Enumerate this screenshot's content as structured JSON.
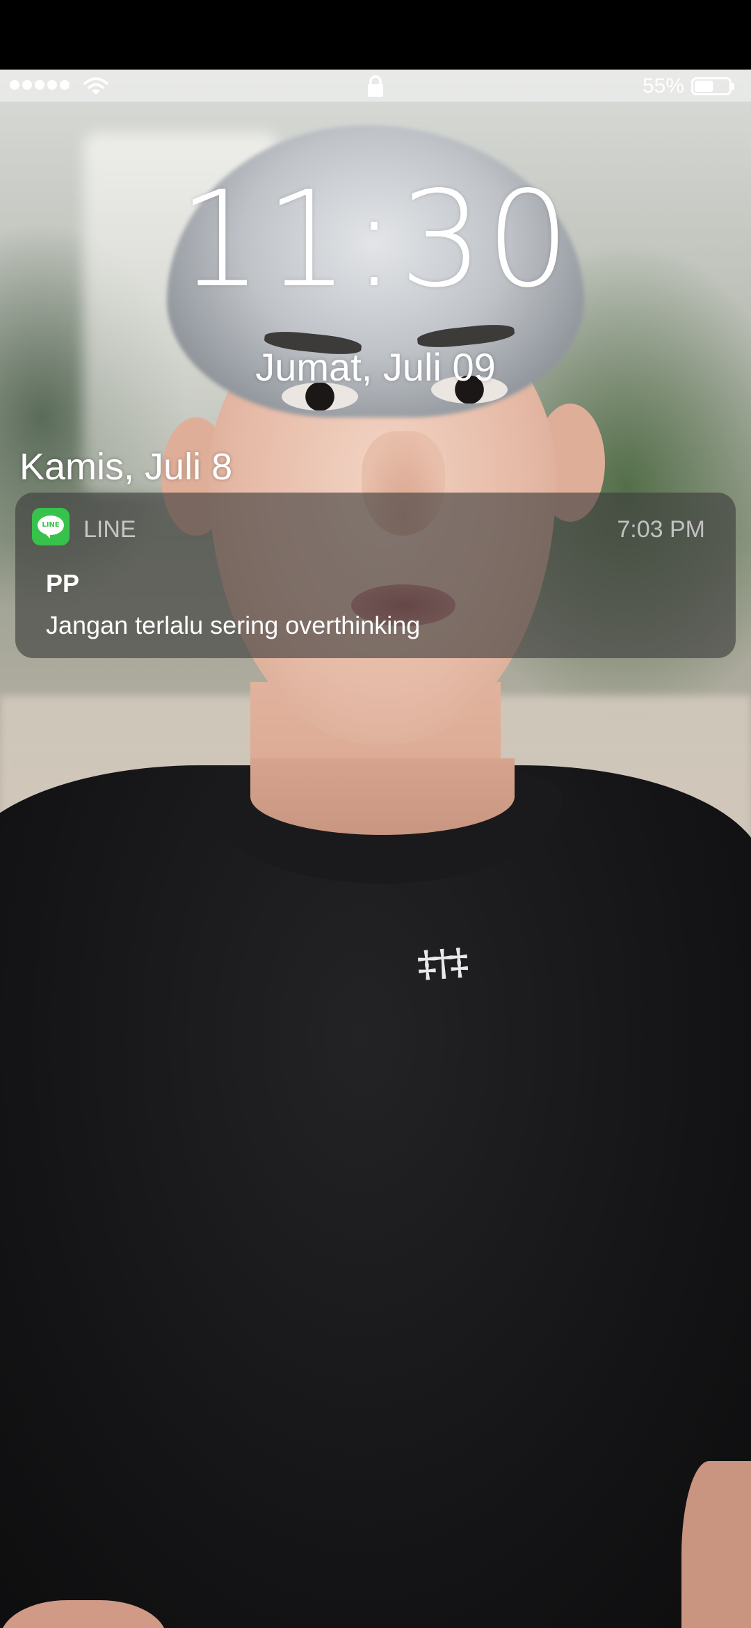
{
  "status_bar": {
    "battery_percent": "55%",
    "battery_level": 0.55,
    "signal_icon": "signal-dots-icon",
    "wifi_icon": "wifi-icon",
    "lock_icon": "lock-icon"
  },
  "lock_screen": {
    "time": "11:30",
    "date": "Jumat, Juli 09"
  },
  "notifications_section": {
    "date_header": "Kamis, Juli 8"
  },
  "notification": {
    "app_name": "LINE",
    "app_icon_text": "LINE",
    "app_icon_color": "#37c24b",
    "time": "7:03 PM",
    "title": "PP",
    "body": "Jangan terlalu sering overthinking"
  }
}
